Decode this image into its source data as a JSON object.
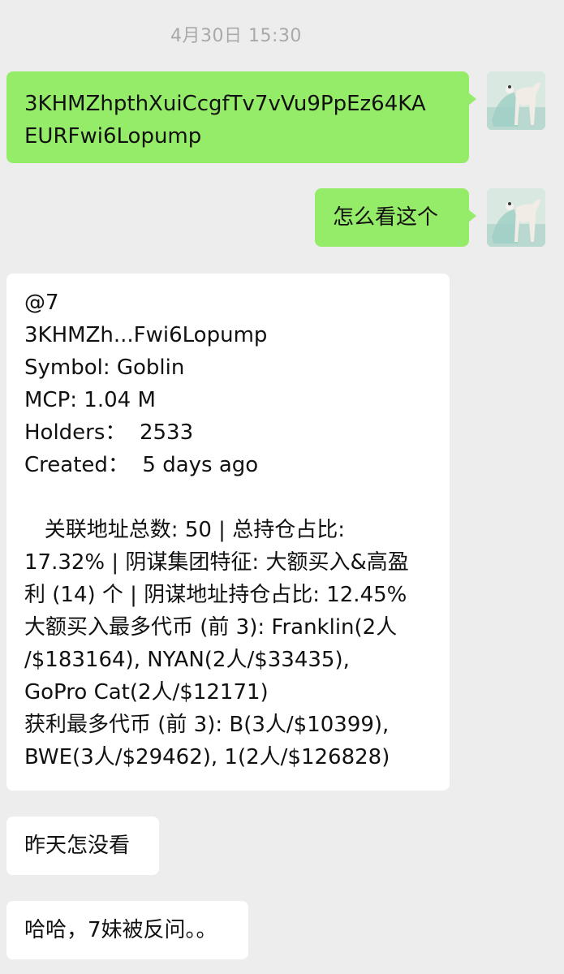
{
  "timestamp": "4月30日 15:30",
  "messages": [
    {
      "side": "out",
      "text_lines": [
        "3KHMZhpthXuiCcgfTv7vVu9PpEz64KA",
        "EURFwi6Lopump"
      ]
    },
    {
      "side": "out",
      "text_lines": [
        "怎么看这个"
      ]
    },
    {
      "side": "in",
      "text_lines": [
        "@7",
        "3KHMZh...Fwi6Lopump",
        "Symbol: Goblin",
        "MCP: 1.04 M",
        "Holders：  2533",
        "Created：  5 days ago",
        "",
        "   关联地址总数: 50 | 总持仓占比:",
        "17.32% | 阴谋集团特征: 大额买入&高盈",
        "利 (14) 个 | 阴谋地址持仓占比: 12.45%",
        "大额买入最多代币 (前 3): Franklin(2人",
        "/$183164), NYAN(2人/$33435),",
        "GoPro Cat(2人/$12171)",
        "获利最多代币 (前 3): B(3人/$10399),",
        "BWE(3人/$29462), 1(2人/$126828)"
      ]
    },
    {
      "side": "in",
      "text_lines": [
        "昨天怎没看"
      ]
    },
    {
      "side": "in",
      "text_lines": [
        "哈哈，7妹被反问。。"
      ]
    }
  ],
  "colors": {
    "background": "#ededed",
    "outgoing_bubble": "#95ec69",
    "incoming_bubble": "#ffffff",
    "timestamp_text": "#a9a9a9"
  },
  "icons": {
    "self_avatar": "horse-painting-avatar"
  }
}
